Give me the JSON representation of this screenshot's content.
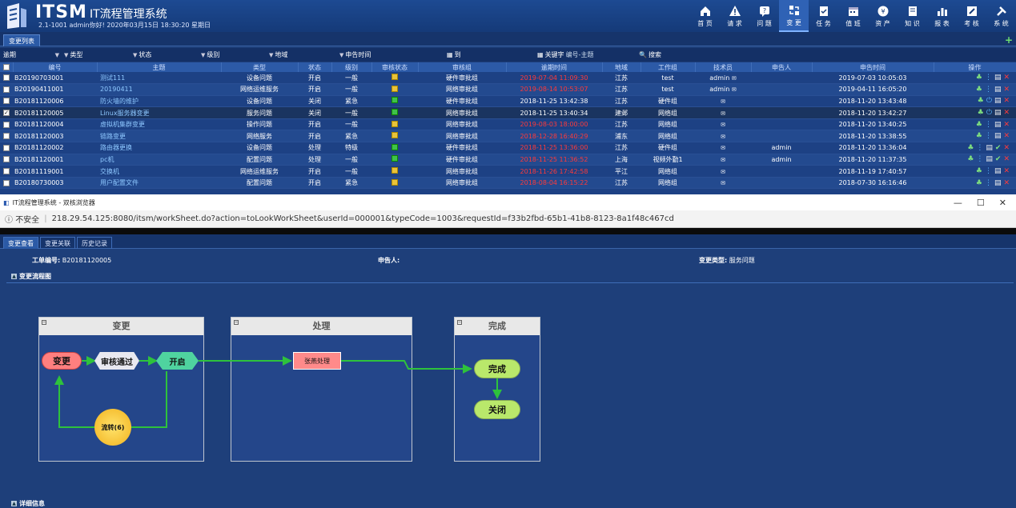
{
  "app": {
    "brand": "ITSM",
    "title": "IT流程管理系统",
    "userline": "2.1-1001 admin你好! 2020年03月15日 18:30:20 星期日"
  },
  "nav": [
    {
      "label": "首 页",
      "icon": "home-icon"
    },
    {
      "label": "请 求",
      "icon": "warning-icon"
    },
    {
      "label": "问 题",
      "icon": "question-icon"
    },
    {
      "label": "变 更",
      "icon": "change-icon",
      "active": true
    },
    {
      "label": "任 务",
      "icon": "task-icon"
    },
    {
      "label": "值 班",
      "icon": "calendar-icon"
    },
    {
      "label": "资 产",
      "icon": "asset-icon"
    },
    {
      "label": "知 识",
      "icon": "book-icon"
    },
    {
      "label": "报 表",
      "icon": "chart-icon"
    },
    {
      "label": "考 核",
      "icon": "edit-icon"
    },
    {
      "label": "系 统",
      "icon": "tools-icon"
    }
  ],
  "list_tab": "变更列表",
  "filters": {
    "overdue": "逾期",
    "type": "类型",
    "status": "状态",
    "level": "级别",
    "region": "地域",
    "apply_time": "申告时间",
    "to": "到",
    "keyword": "关键字",
    "keyword_placeholder": "编号-主题",
    "search": "搜索"
  },
  "columns": [
    "编号",
    "主题",
    "类型",
    "状态",
    "级别",
    "审核状态",
    "审核组",
    "逾期时间",
    "地域",
    "工作组",
    "技术员",
    "申告人",
    "申告时间",
    "操作"
  ],
  "rows": [
    {
      "id": "B20190703001",
      "subject": "测试111",
      "type": "设备问题",
      "status": "开启",
      "level": "一般",
      "audit": "y",
      "group": "硬件审批组",
      "due": "2019-07-04 11:09:30",
      "due_red": true,
      "region": "江苏",
      "team": "test",
      "tech": "admin",
      "reporter": "",
      "time": "2019-07-03 10:05:03"
    },
    {
      "id": "B20190411001",
      "subject": "20190411",
      "type": "网络运维服务",
      "status": "开启",
      "level": "一般",
      "audit": "y",
      "group": "网络审批组",
      "due": "2019-08-14 10:53:07",
      "due_red": true,
      "region": "江苏",
      "team": "test",
      "tech": "admin",
      "reporter": "",
      "time": "2019-04-11 16:05:20"
    },
    {
      "id": "B20181120006",
      "subject": "防火墙的维护",
      "type": "设备问题",
      "status": "关闭",
      "level": "紧急",
      "audit": "g",
      "group": "硬件审批组",
      "due": "2018-11-25 13:42:38",
      "due_red": false,
      "region": "江苏",
      "team": "硬件组",
      "tech": "",
      "reporter": "",
      "time": "2018-11-20 13:43:48"
    },
    {
      "id": "B20181120005",
      "subject": "Linux服务器变更",
      "type": "服务问题",
      "status": "关闭",
      "level": "一般",
      "audit": "g",
      "group": "网络审批组",
      "due": "2018-11-25 13:40:34",
      "due_red": false,
      "region": "建邺",
      "team": "网络组",
      "tech": "",
      "reporter": "",
      "time": "2018-11-20 13:42:27",
      "checked": true
    },
    {
      "id": "B20181120004",
      "subject": "虚拟机集群变更",
      "type": "操作问题",
      "status": "开启",
      "level": "一般",
      "audit": "y",
      "group": "网络审批组",
      "due": "2019-08-03 18:00:00",
      "due_red": true,
      "region": "江苏",
      "team": "网络组",
      "tech": "",
      "reporter": "",
      "time": "2018-11-20 13:40:25"
    },
    {
      "id": "B20181120003",
      "subject": "链路变更",
      "type": "网络服务",
      "status": "开启",
      "level": "紧急",
      "audit": "y",
      "group": "网络审批组",
      "due": "2018-12-28 16:40:29",
      "due_red": true,
      "region": "浦东",
      "team": "网络组",
      "tech": "",
      "reporter": "",
      "time": "2018-11-20 13:38:55"
    },
    {
      "id": "B20181120002",
      "subject": "路由器更换",
      "type": "设备问题",
      "status": "处理",
      "level": "特级",
      "audit": "g",
      "group": "硬件审批组",
      "due": "2018-11-25 13:36:00",
      "due_red": true,
      "region": "江苏",
      "team": "硬件组",
      "tech": "",
      "reporter": "admin",
      "time": "2018-11-20 13:36:04"
    },
    {
      "id": "B20181120001",
      "subject": "pc机",
      "type": "配置问题",
      "status": "处理",
      "level": "一般",
      "audit": "g",
      "group": "硬件审批组",
      "due": "2018-11-25 11:36:52",
      "due_red": true,
      "region": "上海",
      "team": "视频外勤1",
      "tech": "",
      "reporter": "admin",
      "time": "2018-11-20 11:37:35"
    },
    {
      "id": "B20181119001",
      "subject": "交换机",
      "type": "网络运维服务",
      "status": "开启",
      "level": "一般",
      "audit": "y",
      "group": "网络审批组",
      "due": "2018-11-26 17:42:58",
      "due_red": true,
      "region": "平江",
      "team": "网络组",
      "tech": "",
      "reporter": "",
      "time": "2018-11-19 17:40:57"
    },
    {
      "id": "B20180730003",
      "subject": "用户配置文件",
      "type": "配置问题",
      "status": "开启",
      "level": "紧急",
      "audit": "y",
      "group": "网络审批组",
      "due": "2018-08-04 16:15:22",
      "due_red": true,
      "region": "江苏",
      "team": "网络组",
      "tech": "",
      "reporter": "",
      "time": "2018-07-30 16:16:46"
    }
  ],
  "popup": {
    "window_title": "IT流程管理系统 - 双核浏览器",
    "insecure": "不安全",
    "url": "218.29.54.125:8080/itsm/workSheet.do?action=toLookWorkSheet&userId=000001&typeCode=1003&requestId=f33b2fbd-65b1-41b8-8123-8a1f48c467cd",
    "tabs": [
      "变更查看",
      "变更关联",
      "历史记录"
    ],
    "order_label": "工单编号:",
    "order_value": "B20181120005",
    "reporter_label": "申告人:",
    "reporter_value": "",
    "type_label": "变更类型:",
    "type_value": "服务问题",
    "flow_section": "变更流程图",
    "detail_section": "详细信息",
    "lanes": [
      "变更",
      "处理",
      "完成"
    ],
    "nodes": {
      "change": "变更",
      "review": "审核通过",
      "open": "开启",
      "transfer": "流转(6)",
      "handler": "张燕处理",
      "done": "完成",
      "close": "关闭"
    }
  },
  "colors": {
    "accent": "#2f62b5",
    "overdue": "#ff3a3a",
    "approved": "#3fc24a",
    "pending": "#e8c33a"
  }
}
